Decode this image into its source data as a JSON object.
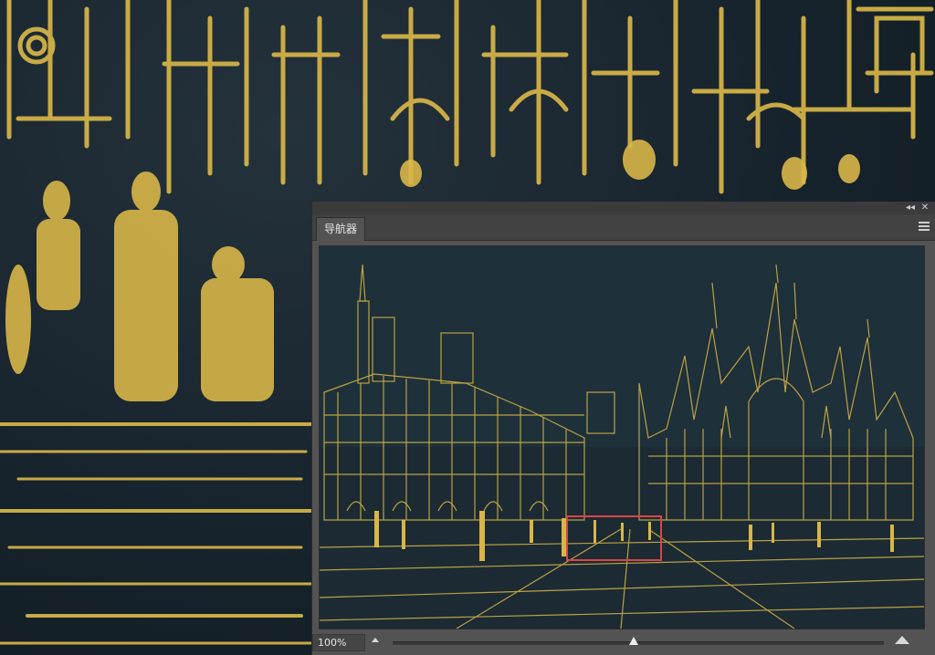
{
  "panel": {
    "tab_label": "导航器",
    "zoom_value": "100%",
    "zoom_level_fraction": 0.49
  },
  "icons": {
    "collapse": "double-chevron-left-icon",
    "close": "close-icon",
    "menu": "hamburger-menu-icon",
    "zoom_out": "small-mountain-icon",
    "zoom_in": "large-mountain-icon"
  },
  "colors": {
    "gold": "#d8b648",
    "canvas_bg": "#16222b",
    "panel_bg": "#535353",
    "view_rect": "#d94545"
  }
}
